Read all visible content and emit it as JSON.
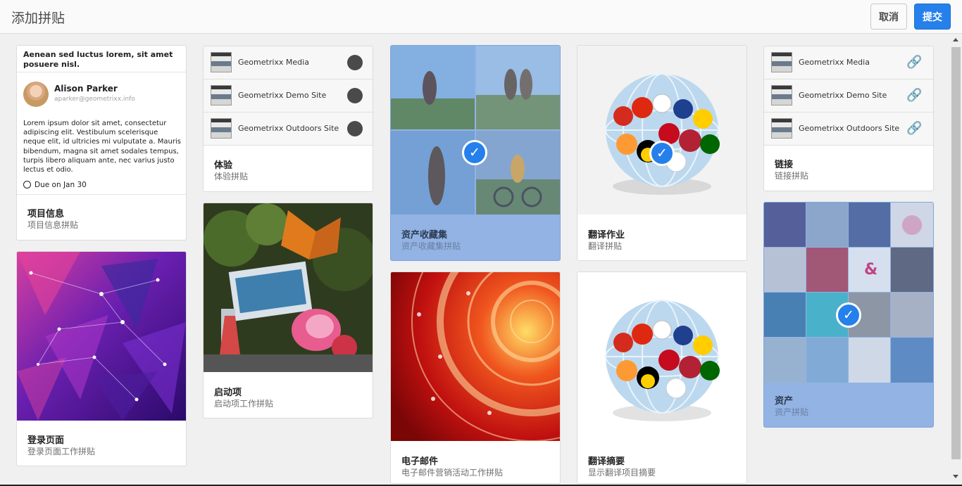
{
  "header": {
    "title": "添加拼贴",
    "cancel_label": "取消",
    "submit_label": "提交"
  },
  "colors": {
    "accent": "#2680eb",
    "selected_card": "#92b3e3"
  },
  "cards": {
    "project_info": {
      "heading": "Aenean sed luctus lorem, sit amet posuere nisl.",
      "person_name": "Alison Parker",
      "person_email": "aparker@geometrixx.info",
      "body": "Lorem ipsum dolor sit amet, consectetur adipiscing elit. Vestibulum scelerisque neque elit, id ultricies mi vulputate a. Mauris bibendum, magna sit amet sodales tempus, turpis libero aliquam ante, nec varius justo lectus et odio.",
      "due": "Due on Jan 30",
      "title": "项目信息",
      "subtitle": "项目信息拼贴"
    },
    "login_page": {
      "title": "登录页面",
      "subtitle": "登录页面工作拼贴"
    },
    "experience": {
      "sites": [
        "Geometrixx Media",
        "Geometrixx Demo Site",
        "Geometrixx Outdoors Site"
      ],
      "title": "体验",
      "subtitle": "体验拼贴"
    },
    "launches": {
      "title": "启动项",
      "subtitle": "启动项工作拼贴"
    },
    "asset_collections": {
      "title": "资产收藏集",
      "subtitle": "资产收藏集拼贴",
      "selected": true
    },
    "email": {
      "title": "电子邮件",
      "subtitle": "电子邮件营销活动工作拼贴"
    },
    "translation_job": {
      "title": "翻译作业",
      "subtitle": "翻译拼贴",
      "selected": true
    },
    "translation_summary": {
      "title": "翻译摘要",
      "subtitle": "显示翻译项目摘要"
    },
    "links": {
      "sites": [
        "Geometrixx Media",
        "Geometrixx Demo Site",
        "Geometrixx Outdoors Site"
      ],
      "title": "链接",
      "subtitle": "链接拼贴"
    },
    "assets": {
      "title": "资产",
      "subtitle": "资产拼贴",
      "selected": true
    }
  }
}
